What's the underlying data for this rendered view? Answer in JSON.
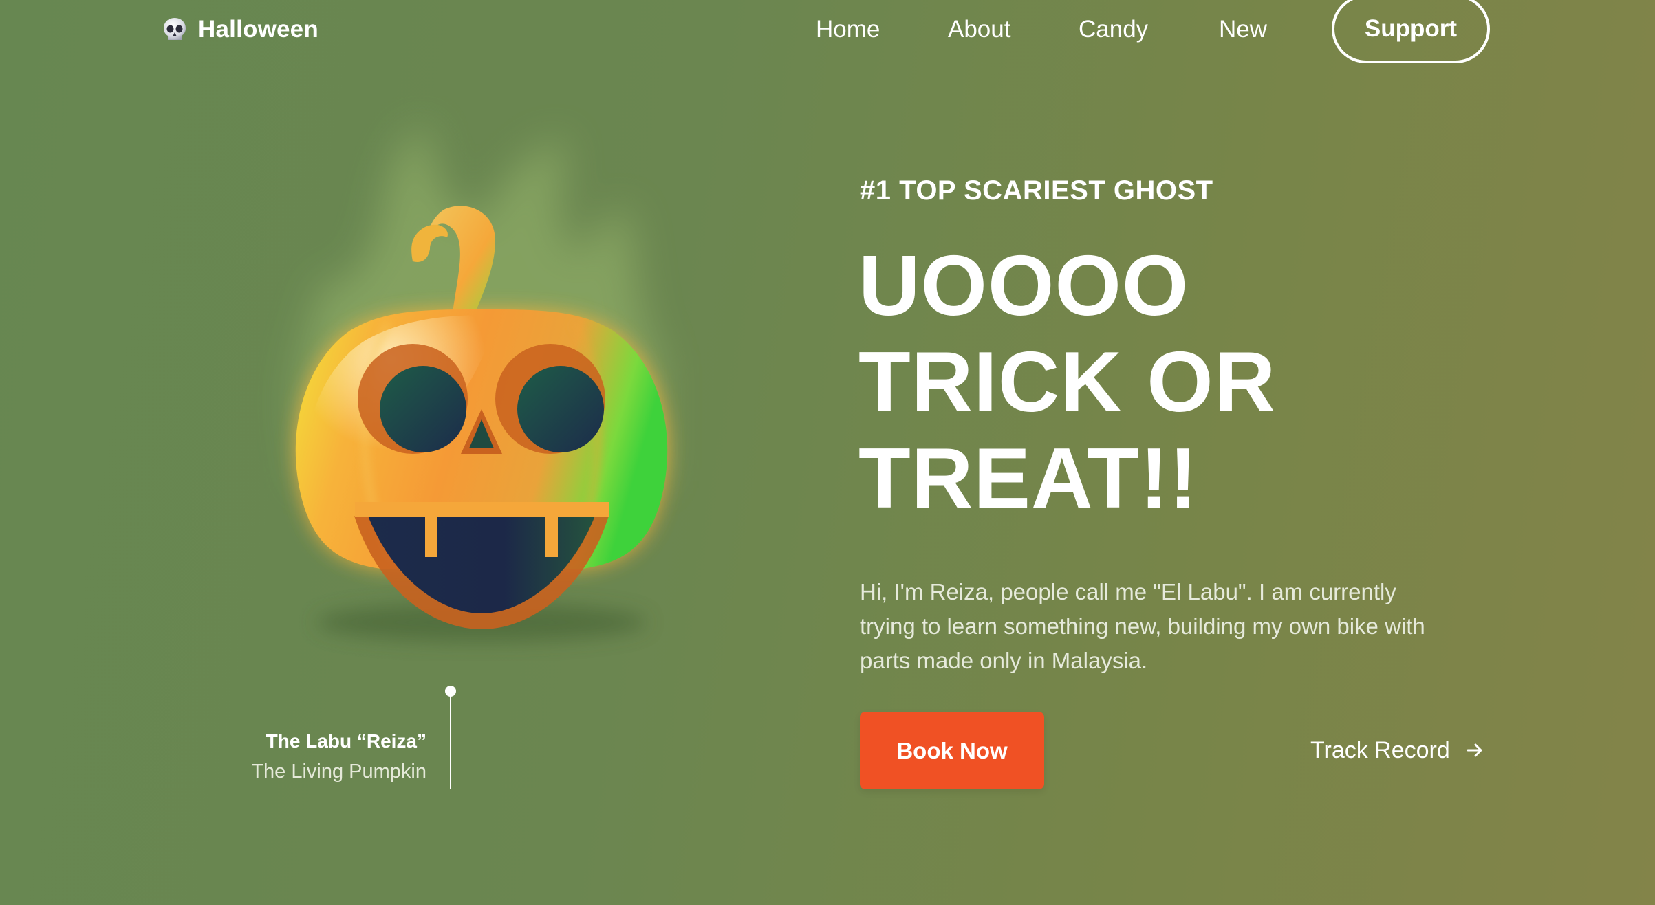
{
  "nav": {
    "brand": "Halloween",
    "brand_icon": "skull-icon",
    "links": [
      "Home",
      "About",
      "Candy",
      "New"
    ],
    "support_label": "Support"
  },
  "hero": {
    "eyebrow": "#1 TOP SCARIEST GHOST",
    "headline": [
      "UOOOO",
      "TRICK OR",
      "TREAT!!"
    ],
    "description": "Hi, I'm Reiza, people call me \"El Labu\". I am currently trying to learn something new, building my own bike with parts made only in Malaysia.",
    "book_label": "Book Now",
    "track_label": "Track Record",
    "track_icon": "arrow-right-icon"
  },
  "character": {
    "name": "The Labu “Reiza”",
    "subtitle": "The Living Pumpkin",
    "image_icon": "pumpkin-icon"
  },
  "colors": {
    "background_start": "#678751",
    "background_end": "#838449",
    "accent": "#f05124",
    "text": "#ffffff"
  }
}
